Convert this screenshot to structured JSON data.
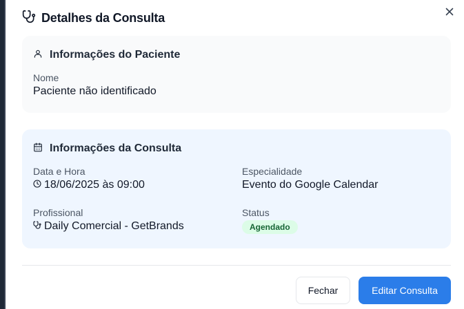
{
  "dialog": {
    "title": "Detalhes da Consulta"
  },
  "patient": {
    "section_title": "Informações do Paciente",
    "name_label": "Nome",
    "name_value": "Paciente não identificado"
  },
  "consultation": {
    "section_title": "Informações da Consulta",
    "datetime_label": "Data e Hora",
    "datetime_value": "18/06/2025 às 09:00",
    "specialty_label": "Especialidade",
    "specialty_value": "Evento do Google Calendar",
    "professional_label": "Profissional",
    "professional_value": "Daily Comercial - GetBrands",
    "status_label": "Status",
    "status_value": "Agendado"
  },
  "footer": {
    "close_label": "Fechar",
    "edit_label": "Editar Consulta"
  },
  "colors": {
    "primary": "#2b7de9",
    "status_bg": "#dcfce7",
    "status_text": "#166534",
    "consult_card_bg": "#eff6ff",
    "patient_card_bg": "#f9fafb"
  },
  "icons": {
    "title": "stethoscope-icon",
    "close": "close-icon",
    "patient": "user-icon",
    "consultation": "calendar-icon",
    "datetime": "clock-icon",
    "professional": "stethoscope-icon"
  }
}
